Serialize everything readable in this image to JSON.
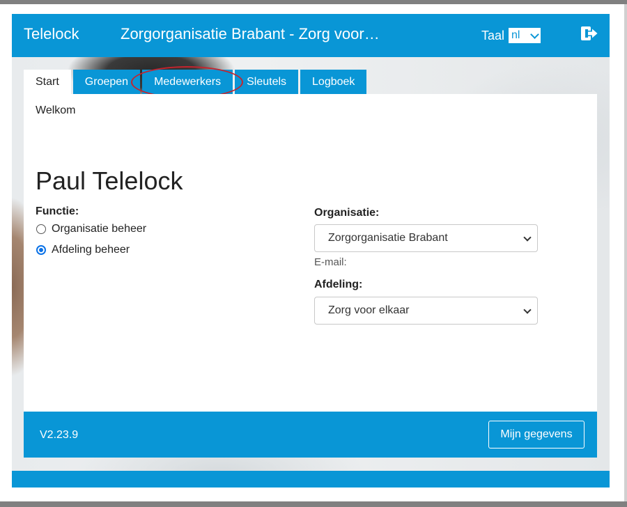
{
  "header": {
    "brand": "Telelock",
    "organization_title": "Zorgorganisatie Brabant - Zorg voor…",
    "language_label": "Taal",
    "language_value": "nl",
    "logout_icon": "logout-icon"
  },
  "tabs": [
    {
      "label": "Start",
      "active": true
    },
    {
      "label": "Groepen",
      "active": false
    },
    {
      "label": "Medewerkers",
      "active": false
    },
    {
      "label": "Sleutels",
      "active": false
    },
    {
      "label": "Logboek",
      "active": false
    }
  ],
  "main": {
    "welcome": "Welkom",
    "user_name": "Paul Telelock",
    "functie_label": "Functie:",
    "functie_options": [
      {
        "label": "Organisatie beheer",
        "checked": false
      },
      {
        "label": "Afdeling beheer",
        "checked": true
      }
    ],
    "organisatie_label": "Organisatie:",
    "organisatie_value": "Zorgorganisatie Brabant",
    "email_label": "E-mail:",
    "afdeling_label": "Afdeling:",
    "afdeling_value": "Zorg voor elkaar"
  },
  "footer": {
    "version": "V2.23.9",
    "my_data_button": "Mijn gegevens"
  },
  "colors": {
    "primary": "#0996d6",
    "highlight_ring": "#c4242e",
    "radio_checked": "#0b72e7"
  }
}
